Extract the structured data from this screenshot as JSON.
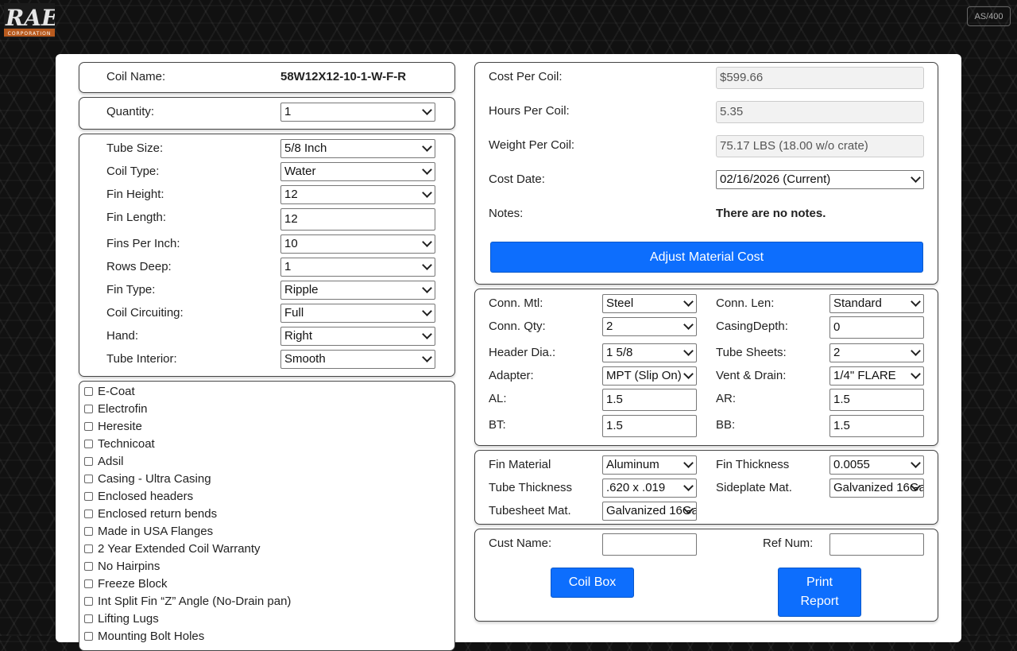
{
  "brand": {
    "logo_text": "RAE",
    "logo_sub": "CORPORATION"
  },
  "header": {
    "as400_label": "AS/400"
  },
  "coil": {
    "name_label": "Coil Name:",
    "name_value": "58W12X12-10-1-W-F-R"
  },
  "quantity": {
    "label": "Quantity:",
    "value": "1"
  },
  "specs": [
    {
      "label": "Tube Size:",
      "value": "5/8 Inch",
      "kind": "select"
    },
    {
      "label": "Coil Type:",
      "value": "Water",
      "kind": "select"
    },
    {
      "label": "Fin Height:",
      "value": "12",
      "kind": "select"
    },
    {
      "label": "Fin Length:",
      "value": "12",
      "kind": "input"
    },
    {
      "label": "Fins Per Inch:",
      "value": "10",
      "kind": "select"
    },
    {
      "label": "Rows Deep:",
      "value": "1",
      "kind": "select"
    },
    {
      "label": "Fin Type:",
      "value": "Ripple",
      "kind": "select"
    },
    {
      "label": "Coil Circuiting:",
      "value": "Full",
      "kind": "select"
    },
    {
      "label": "Hand:",
      "value": "Right",
      "kind": "select"
    },
    {
      "label": "Tube Interior:",
      "value": "Smooth",
      "kind": "select"
    }
  ],
  "options": [
    "E-Coat",
    "Electrofin",
    "Heresite",
    "Technicoat",
    "Adsil",
    "Casing - Ultra Casing",
    "Enclosed headers",
    "Enclosed return bends",
    "Made in USA Flanges",
    "2 Year Extended Coil Warranty",
    "No Hairpins",
    "Freeze Block",
    "Int Split Fin “Z” Angle (No-Drain pan)",
    "Lifting Lugs",
    "Mounting Bolt Holes"
  ],
  "cost": {
    "cost_label": "Cost Per Coil:",
    "cost_value": "$599.66",
    "hours_label": "Hours Per Coil:",
    "hours_value": "5.35",
    "weight_label": "Weight Per Coil:",
    "weight_value": "75.17 LBS (18.00 w/o crate)",
    "date_label": "Cost Date:",
    "date_value": "02/16/2026 (Current)",
    "notes_label": "Notes:",
    "notes_value": "There are no notes.",
    "adjust_button": "Adjust Material Cost"
  },
  "connections": {
    "conn_mtl_label": "Conn. Mtl:",
    "conn_mtl_value": "Steel",
    "conn_len_label": "Conn. Len:",
    "conn_len_value": "Standard",
    "conn_qty_label": "Conn. Qty:",
    "conn_qty_value": "2",
    "casing_label": "CasingDepth:",
    "casing_value": "0",
    "header_label": "Header Dia.:",
    "header_value": "1 5/8",
    "tube_sheets_label": "Tube Sheets:",
    "tube_sheets_value": "2",
    "adapter_label": "Adapter:",
    "adapter_value": "MPT (Slip On)",
    "vent_label": "Vent & Drain:",
    "vent_value": "1/4\" FLARE",
    "al_label": "AL:",
    "al_value": "1.5",
    "ar_label": "AR:",
    "ar_value": "1.5",
    "bt_label": "BT:",
    "bt_value": "1.5",
    "bb_label": "BB:",
    "bb_value": "1.5"
  },
  "materials": {
    "fin_material_label": "Fin Material",
    "fin_material_value": "Aluminum",
    "fin_thickness_label": "Fin Thickness",
    "fin_thickness_value": "0.0055",
    "tube_thickness_label": "Tube Thickness",
    "tube_thickness_value": ".620 x .019",
    "sideplate_label": "Sideplate Mat.",
    "sideplate_value": "Galvanized 16Ga",
    "tubesheet_label": "Tubesheet Mat.",
    "tubesheet_value": "Galvanized 16Ga"
  },
  "report": {
    "cust_name_label": "Cust Name:",
    "cust_name_value": "",
    "ref_num_label": "Ref Num:",
    "ref_num_value": "",
    "coil_box_button": "Coil Box",
    "print_button_line1": "Print",
    "print_button_line2": "Report"
  },
  "colors": {
    "primary": "#0d6efd",
    "background": "#111111",
    "panel": "#ffffff"
  }
}
